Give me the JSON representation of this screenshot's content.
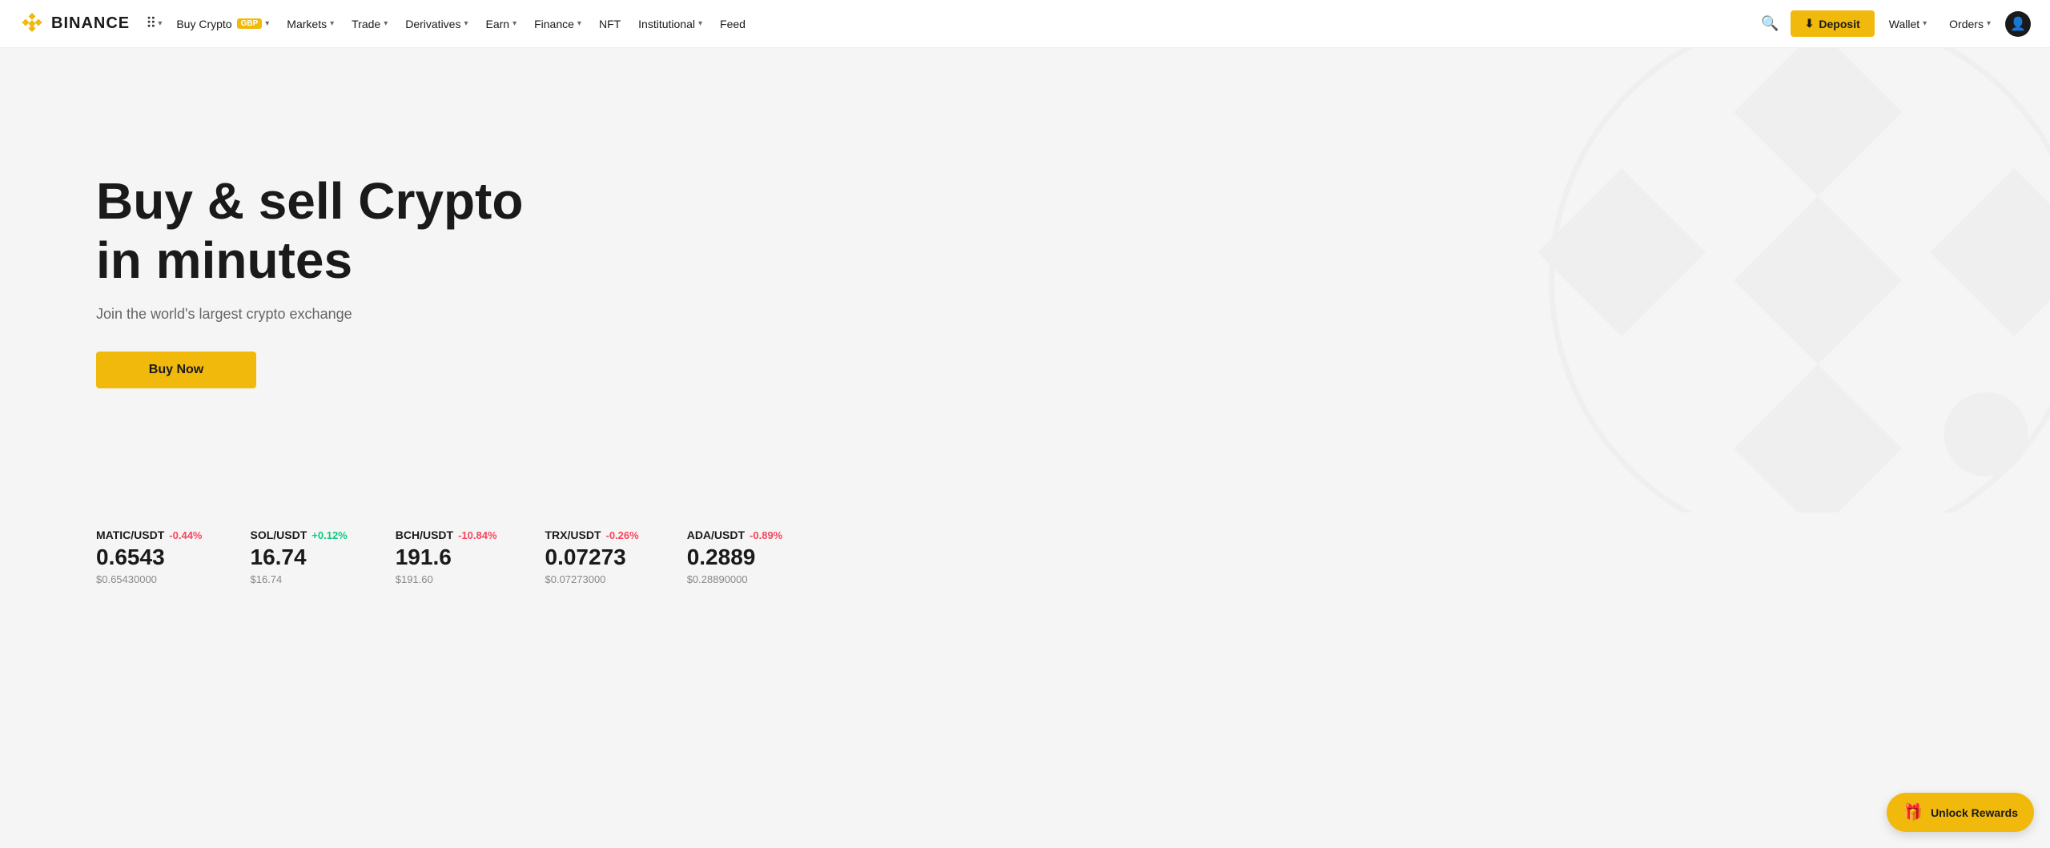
{
  "brand": {
    "name": "BINANCE",
    "logo_color": "#f0b90b"
  },
  "navbar": {
    "buy_crypto_label": "Buy Crypto",
    "buy_crypto_badge": "GBP",
    "markets_label": "Markets",
    "trade_label": "Trade",
    "derivatives_label": "Derivatives",
    "earn_label": "Earn",
    "finance_label": "Finance",
    "nft_label": "NFT",
    "institutional_label": "Institutional",
    "feed_label": "Feed",
    "deposit_label": "Deposit",
    "wallet_label": "Wallet",
    "orders_label": "Orders"
  },
  "hero": {
    "title": "Buy & sell Crypto in minutes",
    "subtitle": "Join the world's largest crypto exchange",
    "cta_label": "Buy Now"
  },
  "tickers": [
    {
      "pair": "MATIC/USDT",
      "change": "-0.44%",
      "change_type": "neg",
      "price": "0.6543",
      "usd": "$0.65430000"
    },
    {
      "pair": "SOL/USDT",
      "change": "+0.12%",
      "change_type": "pos",
      "price": "16.74",
      "usd": "$16.74"
    },
    {
      "pair": "BCH/USDT",
      "change": "-10.84%",
      "change_type": "neg",
      "price": "191.6",
      "usd": "$191.60"
    },
    {
      "pair": "TRX/USDT",
      "change": "-0.26%",
      "change_type": "neg",
      "price": "0.07273",
      "usd": "$0.07273000"
    },
    {
      "pair": "ADA/USDT",
      "change": "-0.89%",
      "change_type": "neg",
      "price": "0.2889",
      "usd": "$0.28890000"
    }
  ],
  "unlock_rewards": {
    "label": "Unlock Rewards"
  }
}
